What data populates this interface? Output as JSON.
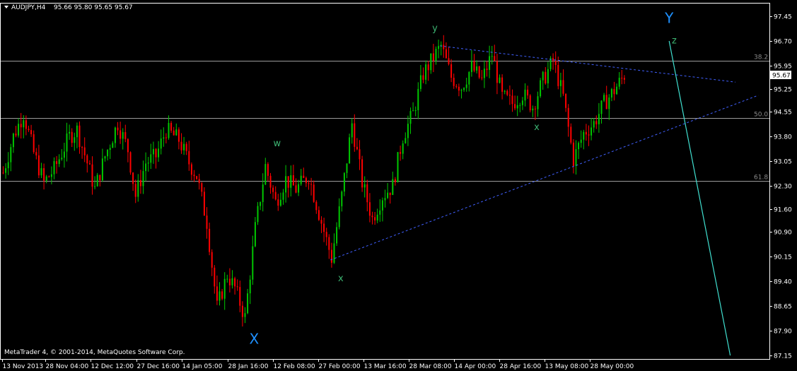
{
  "header": {
    "symbol_timeframe": "AUDJPY,H4",
    "ohlc": "95.66 95.80 95.65 95.67"
  },
  "footer": {
    "copyright": "MetaTrader 4, © 2001-2014, MetaQuotes Software Corp."
  },
  "colors": {
    "background": "#000000",
    "axis": "#ffffff",
    "bull": "#00c800",
    "bear": "#ff0000",
    "level_line": "#9a9a9a",
    "trendline": "#4060ff",
    "wave_label_blue": "#1e90ff",
    "wave_label_green": "#3cb371",
    "projection_line": "#40e0d0"
  },
  "chart_data": {
    "type": "candlestick",
    "price_range": [
      87.15,
      97.8
    ],
    "current_price": "95.67",
    "y_ticks": [
      "97.45",
      "96.70",
      "95.95",
      "95.25",
      "94.55",
      "93.80",
      "93.05",
      "92.30",
      "91.60",
      "90.90",
      "90.15",
      "89.40",
      "88.65",
      "87.90",
      "87.15"
    ],
    "x_ticks": [
      "13 Nov 2013",
      "28 Nov 04:00",
      "12 Dec 12:00",
      "27 Dec 16:00",
      "14 Jan 05:00",
      "28 Jan 16:00",
      "12 Feb 08:00",
      "27 Feb 00:00",
      "13 Mar 16:00",
      "28 Mar 08:00",
      "14 Apr 00:00",
      "28 Apr 16:00",
      "13 May 08:00",
      "28 May 00:00"
    ],
    "fib_levels": [
      {
        "label": "38.2",
        "price": 96.1
      },
      {
        "label": "50.0",
        "price": 94.35
      },
      {
        "label": "61.8",
        "price": 92.45
      }
    ],
    "price_path": [
      {
        "bar": 0,
        "price": 92.7
      },
      {
        "bar": 4,
        "price": 93.8
      },
      {
        "bar": 8,
        "price": 94.5
      },
      {
        "bar": 12,
        "price": 93.3
      },
      {
        "bar": 16,
        "price": 92.4
      },
      {
        "bar": 20,
        "price": 92.8
      },
      {
        "bar": 26,
        "price": 93.8
      },
      {
        "bar": 29,
        "price": 94.0
      },
      {
        "bar": 33,
        "price": 93.0
      },
      {
        "bar": 36,
        "price": 92.2
      },
      {
        "bar": 40,
        "price": 93.2
      },
      {
        "bar": 45,
        "price": 94.2
      },
      {
        "bar": 49,
        "price": 93.4
      },
      {
        "bar": 52,
        "price": 92.0
      },
      {
        "bar": 56,
        "price": 93.0
      },
      {
        "bar": 60,
        "price": 93.2
      },
      {
        "bar": 64,
        "price": 94.0
      },
      {
        "bar": 69,
        "price": 93.7
      },
      {
        "bar": 73,
        "price": 93.0
      },
      {
        "bar": 76,
        "price": 92.6
      },
      {
        "bar": 80,
        "price": 91.2
      },
      {
        "bar": 84,
        "price": 88.6
      },
      {
        "bar": 88,
        "price": 89.6
      },
      {
        "bar": 91,
        "price": 89.2
      },
      {
        "bar": 95,
        "price": 88.3
      },
      {
        "bar": 99,
        "price": 91.0
      },
      {
        "bar": 103,
        "price": 92.9
      },
      {
        "bar": 107,
        "price": 91.8
      },
      {
        "bar": 111,
        "price": 92.5
      },
      {
        "bar": 115,
        "price": 92.2
      },
      {
        "bar": 120,
        "price": 92.6
      },
      {
        "bar": 125,
        "price": 91.2
      },
      {
        "bar": 129,
        "price": 90.1
      },
      {
        "bar": 133,
        "price": 92.0
      },
      {
        "bar": 137,
        "price": 94.2
      },
      {
        "bar": 141,
        "price": 92.4
      },
      {
        "bar": 145,
        "price": 91.3
      },
      {
        "bar": 149,
        "price": 92.0
      },
      {
        "bar": 153,
        "price": 92.3
      },
      {
        "bar": 157,
        "price": 93.8
      },
      {
        "bar": 161,
        "price": 94.5
      },
      {
        "bar": 165,
        "price": 95.7
      },
      {
        "bar": 169,
        "price": 96.2
      },
      {
        "bar": 172,
        "price": 96.55
      },
      {
        "bar": 176,
        "price": 95.6
      },
      {
        "bar": 180,
        "price": 95.3
      },
      {
        "bar": 184,
        "price": 95.9
      },
      {
        "bar": 188,
        "price": 95.5
      },
      {
        "bar": 192,
        "price": 96.3
      },
      {
        "bar": 196,
        "price": 95.0
      },
      {
        "bar": 200,
        "price": 94.8
      },
      {
        "bar": 204,
        "price": 95.1
      },
      {
        "bar": 208,
        "price": 94.7
      },
      {
        "bar": 212,
        "price": 95.5
      },
      {
        "bar": 216,
        "price": 96.1
      },
      {
        "bar": 220,
        "price": 95.0
      },
      {
        "bar": 224,
        "price": 93.1
      },
      {
        "bar": 228,
        "price": 93.9
      },
      {
        "bar": 232,
        "price": 94.2
      },
      {
        "bar": 236,
        "price": 94.8
      },
      {
        "bar": 240,
        "price": 95.2
      },
      {
        "bar": 244,
        "price": 95.67
      }
    ],
    "trendlines": [
      {
        "name": "upper",
        "from": {
          "bar": 172,
          "price": 96.55
        },
        "to": {
          "bar": 288,
          "price": 95.45
        }
      },
      {
        "name": "lower",
        "from": {
          "bar": 129,
          "price": 90.05
        },
        "to": {
          "bar": 297,
          "price": 95.05
        }
      }
    ],
    "projection_line": {
      "from": {
        "bar": 262,
        "price": 96.7
      },
      "to": {
        "bar": 286,
        "price": 87.15
      }
    },
    "wave_labels": [
      {
        "text": "Y",
        "bar": 262,
        "price": 97.25,
        "color": "blue",
        "size": "large"
      },
      {
        "text": "z",
        "bar": 264,
        "price": 96.62,
        "color": "green",
        "size": "small"
      },
      {
        "text": "y",
        "bar": 170,
        "price": 97.0,
        "color": "green",
        "size": "small"
      },
      {
        "text": "w",
        "bar": 108,
        "price": 93.5,
        "color": "green",
        "size": "small"
      },
      {
        "text": "x",
        "bar": 210,
        "price": 94.0,
        "color": "green",
        "size": "small"
      },
      {
        "text": "x",
        "bar": 133,
        "price": 89.4,
        "color": "green",
        "size": "small"
      },
      {
        "text": "X",
        "bar": 99,
        "price": 87.5,
        "color": "blue",
        "size": "large"
      }
    ]
  }
}
